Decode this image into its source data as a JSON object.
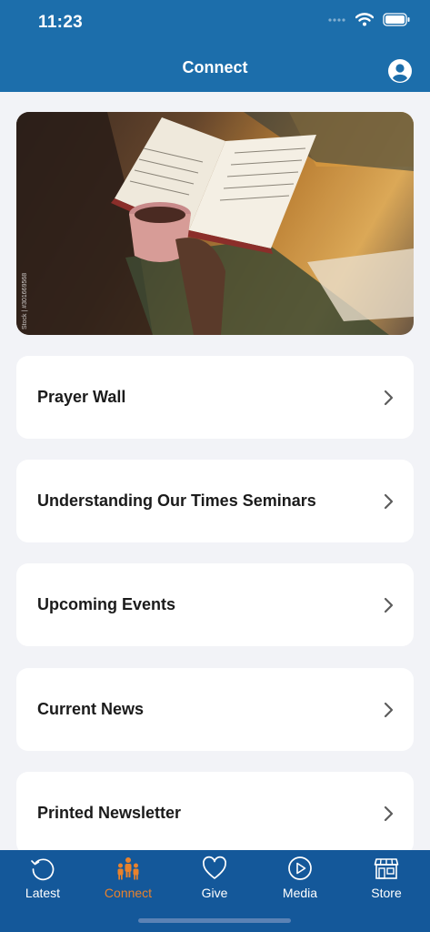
{
  "status": {
    "time": "11:23"
  },
  "header": {
    "title": "Connect"
  },
  "hero": {
    "credit": "Stock | #301669568"
  },
  "menu": [
    {
      "label": "Prayer Wall"
    },
    {
      "label": "Understanding Our Times Seminars"
    },
    {
      "label": "Upcoming Events"
    },
    {
      "label": "Current News"
    },
    {
      "label": "Printed Newsletter"
    }
  ],
  "tabs": [
    {
      "label": "Latest",
      "icon": "history-icon"
    },
    {
      "label": "Connect",
      "icon": "people-icon",
      "active": true
    },
    {
      "label": "Give",
      "icon": "heart-icon"
    },
    {
      "label": "Media",
      "icon": "play-circle-icon"
    },
    {
      "label": "Store",
      "icon": "storefront-icon"
    }
  ],
  "colors": {
    "header": "#1c6eab",
    "tabbar": "#14589a",
    "accent": "#e9822c",
    "background": "#f2f3f7"
  }
}
